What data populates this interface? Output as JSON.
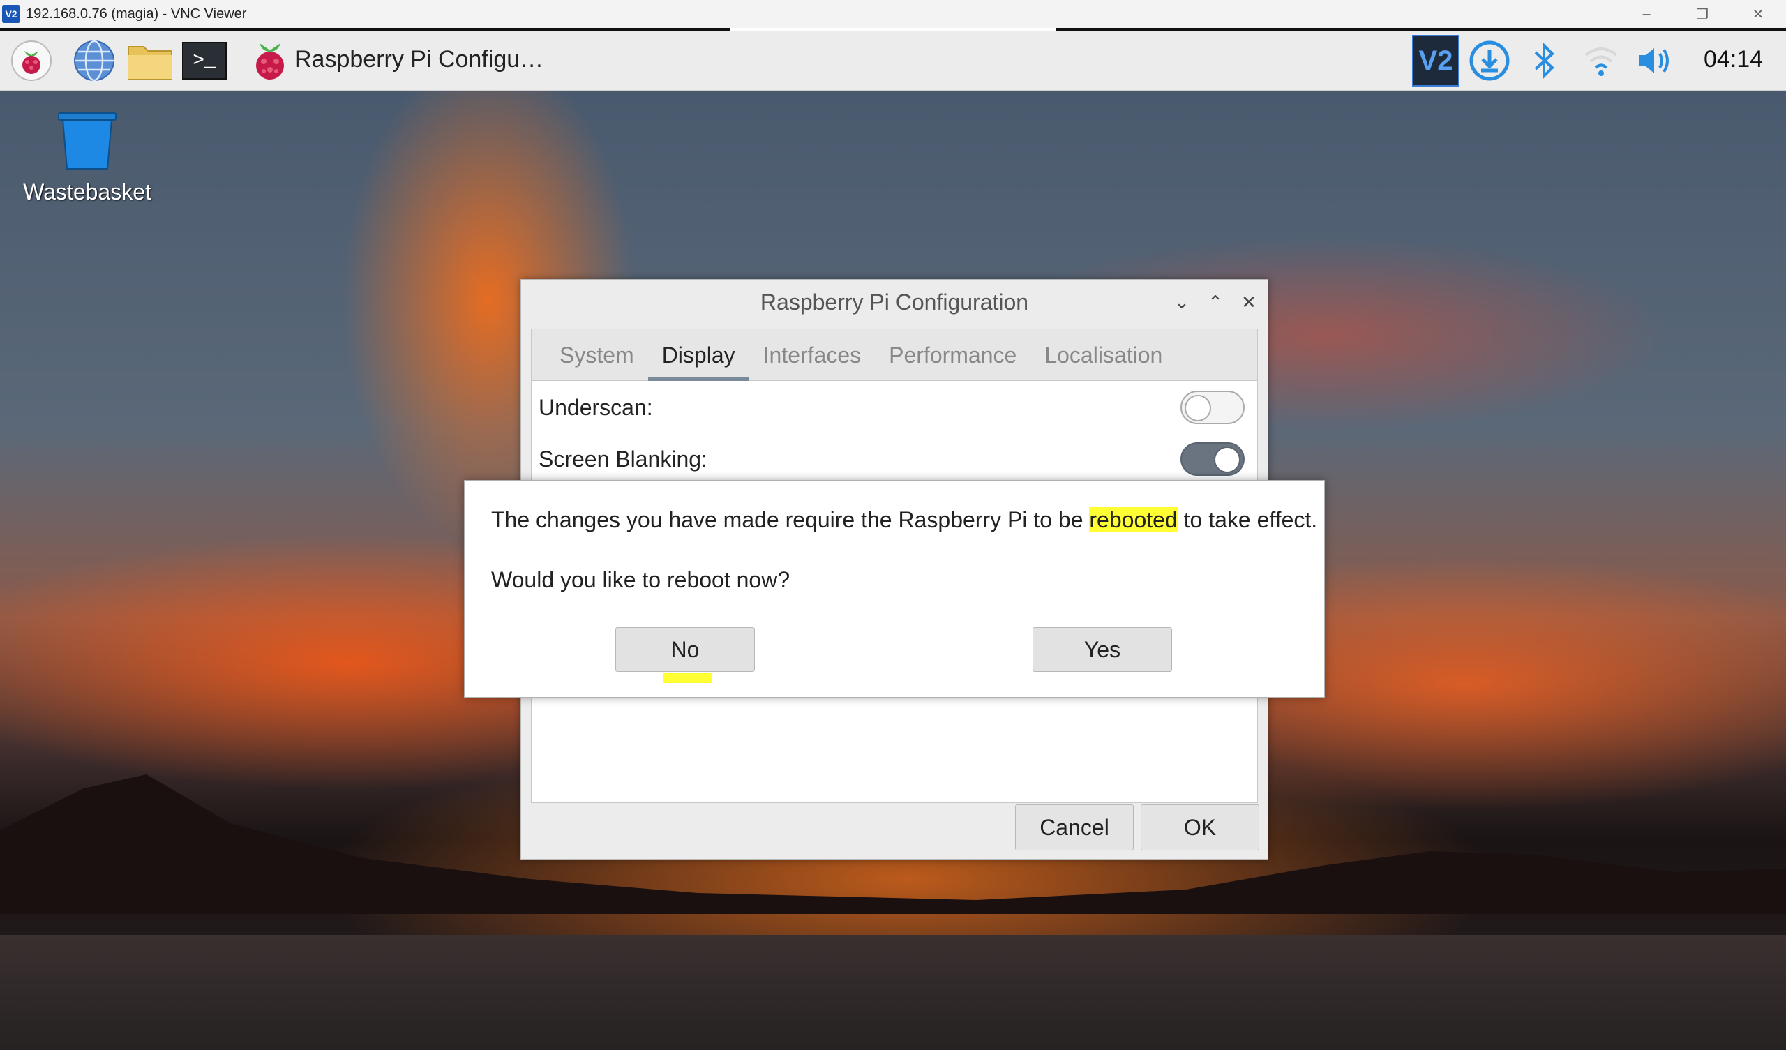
{
  "vnc": {
    "logo": "V2",
    "title": "192.168.0.76 (magia) - VNC Viewer",
    "minimize": "–",
    "restore": "❐",
    "close": "✕"
  },
  "taskbar": {
    "app_label": "Raspberry Pi Configu…",
    "clock": "04:14",
    "terminal_glyph": ">_",
    "vnc_tray": "V2"
  },
  "desktop": {
    "wastebasket_label": "Wastebasket"
  },
  "config_window": {
    "title": "Raspberry Pi Configuration",
    "tabs": [
      "System",
      "Display",
      "Interfaces",
      "Performance",
      "Localisation"
    ],
    "active_tab": "Display",
    "rows": [
      {
        "label": "Underscan:",
        "state": "off"
      },
      {
        "label": "Screen Blanking:",
        "state": "on"
      }
    ],
    "cancel": "Cancel",
    "ok": "OK"
  },
  "reboot_dialog": {
    "message_before": "The changes you have made require the Raspberry Pi to be ",
    "message_highlight": "rebooted",
    "message_after": " to take effect.",
    "question": "Would you like to reboot now?",
    "no": "No",
    "yes": "Yes"
  },
  "colors": {
    "highlight": "#ffff33",
    "vnc_blue": "#1a56b5"
  }
}
